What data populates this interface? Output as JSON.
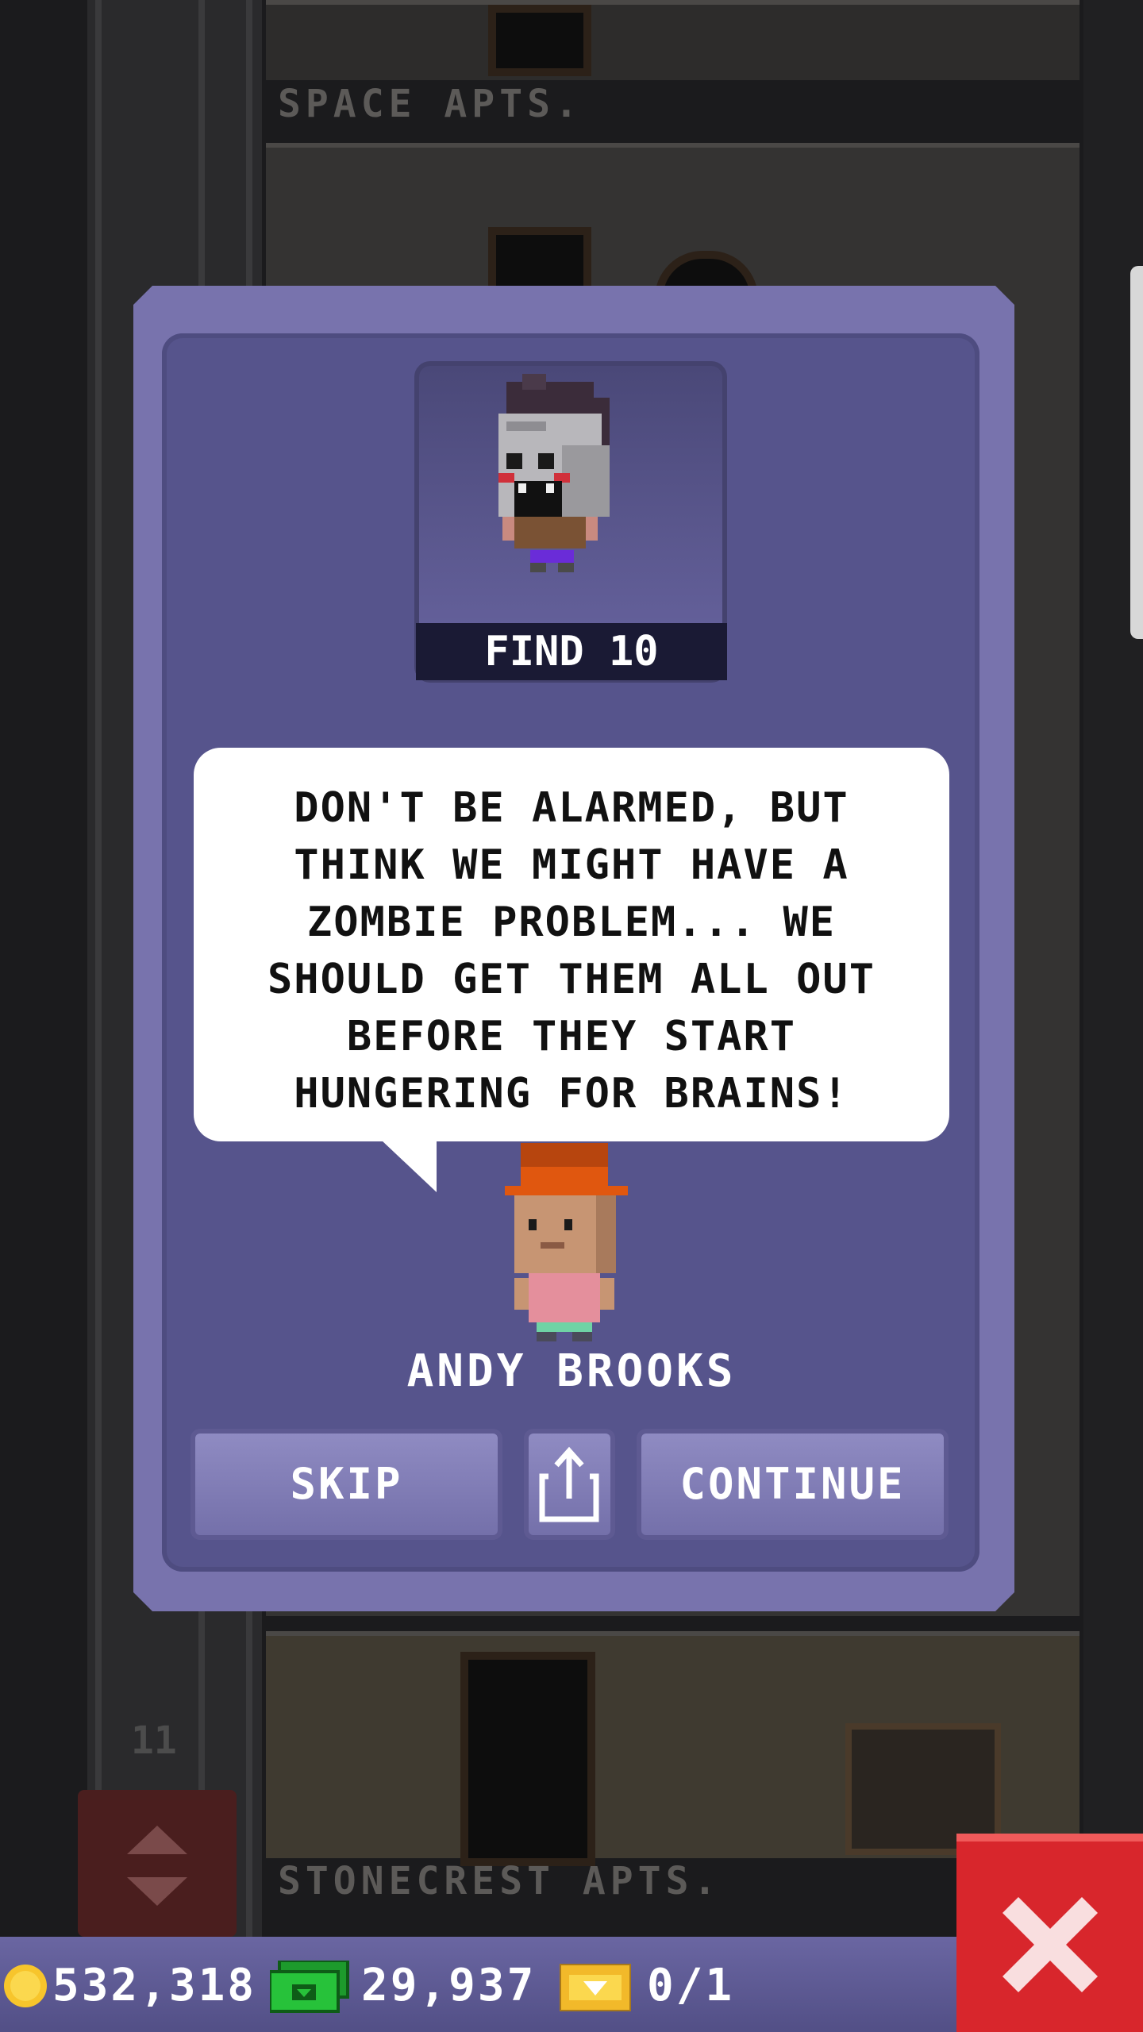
{
  "background": {
    "floors": [
      "SPACE APTS.",
      "STONECREST APTS."
    ],
    "floor_numbers": [
      "11"
    ]
  },
  "dialog": {
    "mission_label": "FIND 10",
    "message": "DON'T BE ALARMED, BUT THINK WE MIGHT HAVE A ZOMBIE PROBLEM... WE SHOULD GET THEM ALL OUT BEFORE THEY START HUNGERING FOR BRAINS!",
    "speaker_name": "ANDY BROOKS",
    "buttons": {
      "skip": "SKIP",
      "continue": "CONTINUE"
    }
  },
  "status_bar": {
    "coins": "532,318",
    "bux": "29,937",
    "tickets": "0/1"
  },
  "icons": {
    "coin": "coin-icon",
    "bux": "bux-icon",
    "ticket": "golden-ticket-icon",
    "share": "share-icon",
    "close": "close-icon"
  },
  "colors": {
    "dialog_border": "#7873ad",
    "dialog_fill": "#56548c",
    "close_button": "#d8262c"
  }
}
